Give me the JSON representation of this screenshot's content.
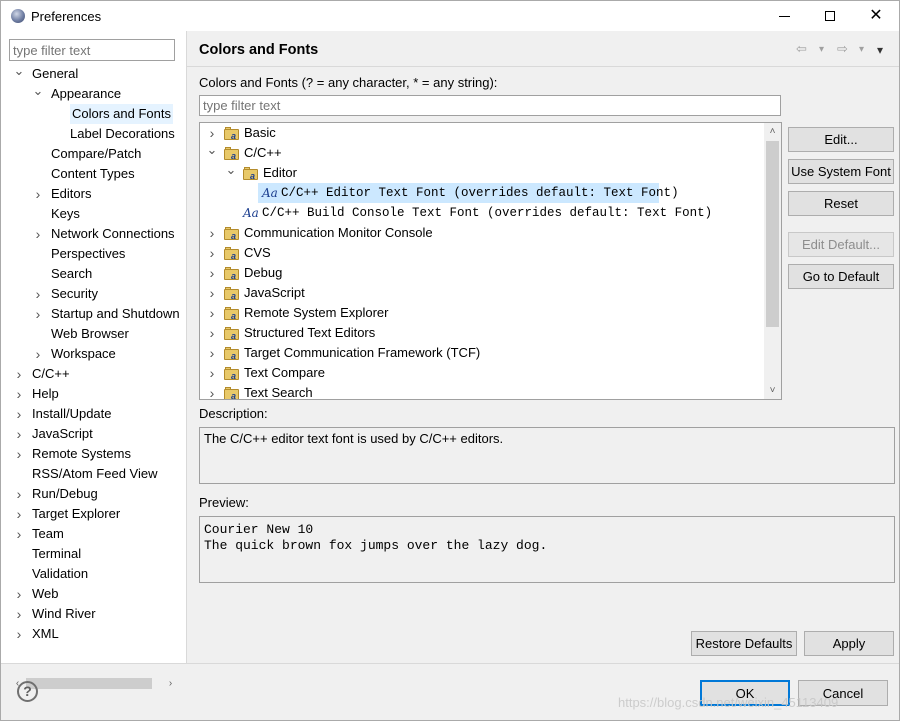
{
  "window": {
    "title": "Preferences",
    "controls": {
      "minimize": "—",
      "maximize": "☐",
      "close": "✕"
    }
  },
  "left": {
    "filter_placeholder": "type filter text",
    "tree": [
      {
        "label": "General",
        "depth": 0,
        "toggle": "expanded"
      },
      {
        "label": "Appearance",
        "depth": 1,
        "toggle": "expanded"
      },
      {
        "label": "Colors and Fonts",
        "depth": 2,
        "toggle": "none",
        "selected": true
      },
      {
        "label": "Label Decorations",
        "depth": 2,
        "toggle": "none"
      },
      {
        "label": "Compare/Patch",
        "depth": 1,
        "toggle": "none"
      },
      {
        "label": "Content Types",
        "depth": 1,
        "toggle": "none"
      },
      {
        "label": "Editors",
        "depth": 1,
        "toggle": "collapsed"
      },
      {
        "label": "Keys",
        "depth": 1,
        "toggle": "none"
      },
      {
        "label": "Network Connections",
        "depth": 1,
        "toggle": "collapsed"
      },
      {
        "label": "Perspectives",
        "depth": 1,
        "toggle": "none"
      },
      {
        "label": "Search",
        "depth": 1,
        "toggle": "none"
      },
      {
        "label": "Security",
        "depth": 1,
        "toggle": "collapsed"
      },
      {
        "label": "Startup and Shutdown",
        "depth": 1,
        "toggle": "collapsed"
      },
      {
        "label": "Web Browser",
        "depth": 1,
        "toggle": "none"
      },
      {
        "label": "Workspace",
        "depth": 1,
        "toggle": "collapsed"
      },
      {
        "label": "C/C++",
        "depth": 0,
        "toggle": "collapsed"
      },
      {
        "label": "Help",
        "depth": 0,
        "toggle": "collapsed"
      },
      {
        "label": "Install/Update",
        "depth": 0,
        "toggle": "collapsed"
      },
      {
        "label": "JavaScript",
        "depth": 0,
        "toggle": "collapsed"
      },
      {
        "label": "Remote Systems",
        "depth": 0,
        "toggle": "collapsed"
      },
      {
        "label": "RSS/Atom Feed View",
        "depth": 0,
        "toggle": "none"
      },
      {
        "label": "Run/Debug",
        "depth": 0,
        "toggle": "collapsed"
      },
      {
        "label": "Target Explorer",
        "depth": 0,
        "toggle": "collapsed"
      },
      {
        "label": "Team",
        "depth": 0,
        "toggle": "collapsed"
      },
      {
        "label": "Terminal",
        "depth": 0,
        "toggle": "none"
      },
      {
        "label": "Validation",
        "depth": 0,
        "toggle": "none"
      },
      {
        "label": "Web",
        "depth": 0,
        "toggle": "collapsed"
      },
      {
        "label": "Wind River",
        "depth": 0,
        "toggle": "collapsed"
      },
      {
        "label": "XML",
        "depth": 0,
        "toggle": "collapsed"
      }
    ]
  },
  "page": {
    "title": "Colors and Fonts",
    "nav": {
      "back": "⇦",
      "back_menu": "▾",
      "forward": "⇨",
      "forward_menu": "▾",
      "view_menu": "▾"
    },
    "filter_label": "Colors and Fonts (? = any character, * = any string):",
    "filter_placeholder": "type filter text",
    "tree": [
      {
        "label": "Basic",
        "depth": 0,
        "toggle": "collapsed",
        "icon": "folder"
      },
      {
        "label": "C/C++",
        "depth": 0,
        "toggle": "expanded",
        "icon": "folder"
      },
      {
        "label": "Editor",
        "depth": 1,
        "toggle": "expanded",
        "icon": "folder"
      },
      {
        "label": "C/C++ Editor Text Font (overrides default: Text Font)",
        "depth": 2,
        "toggle": "none",
        "icon": "font",
        "mono": true,
        "selected": true
      },
      {
        "label": "C/C++ Build Console Text Font (overrides default: Text Font)",
        "depth": 1,
        "toggle": "none",
        "icon": "font",
        "mono": true
      },
      {
        "label": "Communication Monitor Console",
        "depth": 0,
        "toggle": "collapsed",
        "icon": "folder"
      },
      {
        "label": "CVS",
        "depth": 0,
        "toggle": "collapsed",
        "icon": "folder"
      },
      {
        "label": "Debug",
        "depth": 0,
        "toggle": "collapsed",
        "icon": "folder"
      },
      {
        "label": "JavaScript",
        "depth": 0,
        "toggle": "collapsed",
        "icon": "folder"
      },
      {
        "label": "Remote System Explorer",
        "depth": 0,
        "toggle": "collapsed",
        "icon": "folder"
      },
      {
        "label": "Structured Text Editors",
        "depth": 0,
        "toggle": "collapsed",
        "icon": "folder"
      },
      {
        "label": "Target Communication Framework (TCF)",
        "depth": 0,
        "toggle": "collapsed",
        "icon": "folder"
      },
      {
        "label": "Text Compare",
        "depth": 0,
        "toggle": "collapsed",
        "icon": "folder"
      },
      {
        "label": "Text Search",
        "depth": 0,
        "toggle": "collapsed",
        "icon": "folder"
      }
    ],
    "font_icon_glyph": "Aa",
    "folder_badge": "a",
    "buttons": {
      "edit": "Edit...",
      "use_system_font": "Use System Font",
      "reset": "Reset",
      "edit_default": "Edit Default...",
      "go_to_default": "Go to Default"
    },
    "description_label": "Description:",
    "description_text": "The C/C++ editor text font is used by C/C++ editors.",
    "preview_label": "Preview:",
    "preview_text": "Courier New 10\nThe quick brown fox jumps over the lazy dog.",
    "restore_defaults": "Restore Defaults",
    "apply": "Apply"
  },
  "footer": {
    "help": "?",
    "ok": "OK",
    "cancel": "Cancel",
    "watermark": "https://blog.csdn.net/weixin_45113409"
  },
  "scroll": {
    "up": "˄",
    "down": "˅",
    "left": "‹",
    "right": "›"
  }
}
